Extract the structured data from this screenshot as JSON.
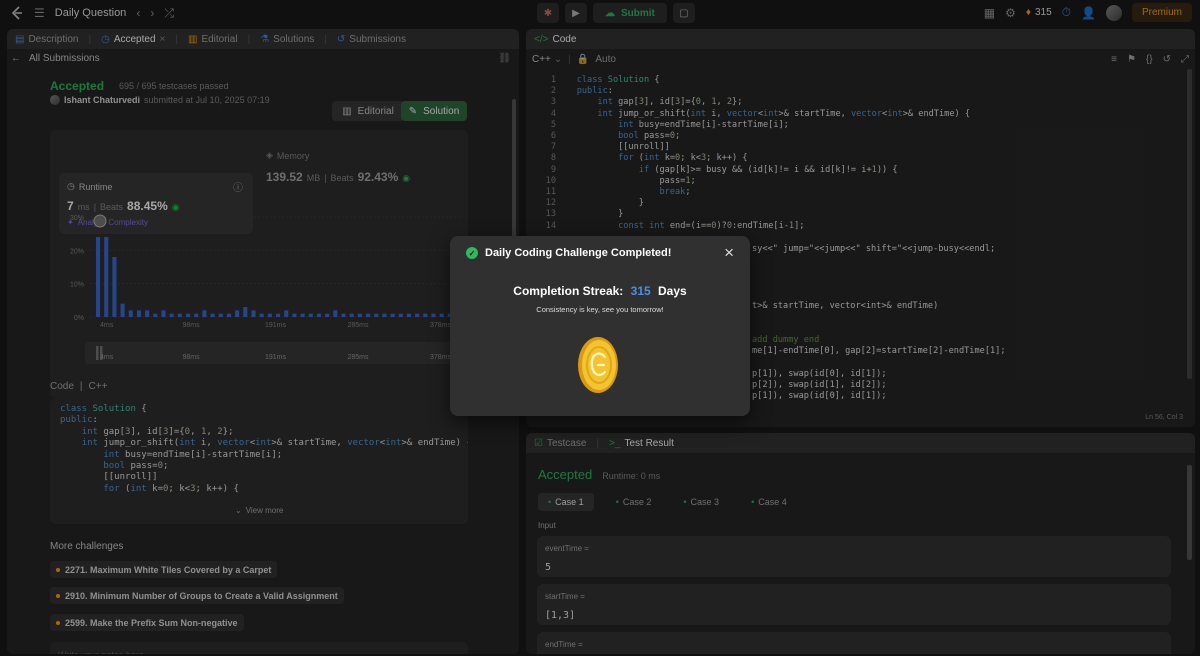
{
  "topbar": {
    "title": "Daily Question",
    "submit": "Submit",
    "streak": "315",
    "premium": "Premium"
  },
  "left_tabs": [
    "Description",
    "Accepted",
    "Editorial",
    "Solutions",
    "Submissions"
  ],
  "all_submissions": "All Submissions",
  "result": {
    "status": "Accepted",
    "testcases": "695 / 695 testcases passed",
    "user": "Ishant Chaturvedi",
    "submitted": "submitted at Jul 10, 2025 07:19",
    "editorial_btn": "Editorial",
    "solution_btn": "Solution"
  },
  "runtime": {
    "label": "Runtime",
    "value": "7",
    "unit": "ms",
    "beats_label": "Beats",
    "beats": "88.45%",
    "analyze": "Analyze Complexity"
  },
  "memory": {
    "label": "Memory",
    "value": "139.52",
    "unit": "MB",
    "beats_label": "Beats",
    "beats": "92.43%"
  },
  "chart_data": {
    "type": "bar",
    "ylabel_ticks": [
      "30%",
      "20%",
      "10%",
      "0%"
    ],
    "xticks": [
      "4ms",
      "98ms",
      "191ms",
      "285ms",
      "378ms"
    ],
    "values": [
      24,
      24,
      18,
      4,
      2,
      2,
      2,
      1,
      2,
      1,
      1,
      1,
      1,
      2,
      1,
      1,
      1,
      2,
      3,
      2,
      1,
      1,
      1,
      2,
      1,
      1,
      1,
      1,
      1,
      2,
      1,
      1,
      1,
      1,
      1,
      1,
      1,
      1,
      1,
      1,
      1,
      1,
      1,
      1
    ],
    "ylim": [
      0,
      30
    ]
  },
  "mini_ticks": [
    "4ms",
    "98ms",
    "191ms",
    "285ms",
    "378ms"
  ],
  "code_label": "Code",
  "code_lang": "C++",
  "code_lines_preview": [
    "class Solution {",
    "public:",
    "    int gap[3], id[3]={0, 1, 2};",
    "    int jump_or_shift(int i, vector<int>& startTime, vector<int>& endTime) {",
    "        int busy=endTime[i]-startTime[i];",
    "        bool pass=0;",
    "        [[unroll]]",
    "        for (int k=0; k<3; k++) {"
  ],
  "view_more": "View more",
  "more_challenges": "More challenges",
  "challenges": [
    "2271. Maximum White Tiles Covered by a Carpet",
    "2910. Minimum Number of Groups to Create a Valid Assignment",
    "2599. Make the Prefix Sum Non-negative"
  ],
  "notes_placeholder": "Write your notes here",
  "editor": {
    "tab": "Code",
    "lang": "C++",
    "auto": "Auto",
    "cursor": "Ln 56, Col 3",
    "lines": [
      {
        "n": "1",
        "t": "class Solution {"
      },
      {
        "n": "2",
        "t": "public:"
      },
      {
        "n": "3",
        "t": "    int gap[3], id[3]={0, 1, 2};"
      },
      {
        "n": "4",
        "t": "    int jump_or_shift(int i, vector<int>& startTime, vector<int>& endTime) {"
      },
      {
        "n": "5",
        "t": "        int busy=endTime[i]-startTime[i];"
      },
      {
        "n": "6",
        "t": "        bool pass=0;"
      },
      {
        "n": "7",
        "t": "        [[unroll]]"
      },
      {
        "n": "8",
        "t": "        for (int k=0; k<3; k++) {"
      },
      {
        "n": "9",
        "t": "            if (gap[k]>= busy && (id[k]!= i && id[k]!= i+1)) {"
      },
      {
        "n": "10",
        "t": "                pass=1;"
      },
      {
        "n": "11",
        "t": "                break;"
      },
      {
        "n": "12",
        "t": "            }"
      },
      {
        "n": "13",
        "t": "        }"
      },
      {
        "n": "14",
        "t": "        const int end=(i==0)?0:endTime[i-1];"
      }
    ],
    "hidden_fragments": [
      "sy<<\" jump=\"<<jump<<\" shift=\"<<jump-busy<<endl;",
      "t>& startTime, vector<int>& endTime)",
      "add dummy end",
      "me[1]-endTime[0], gap[2]=startTime[2]-endTime[1];",
      "p[1]), swap(id[0], id[1]);",
      "p[2]), swap(id[1], id[2]);",
      "p[1]), swap(id[0], id[1]);"
    ]
  },
  "testpanel": {
    "tab1": "Testcase",
    "tab2": "Test Result",
    "status": "Accepted",
    "runtime": "Runtime: 0 ms",
    "cases": [
      "Case 1",
      "Case 2",
      "Case 3",
      "Case 4"
    ],
    "input_label": "Input",
    "fields": [
      {
        "label": "eventTime =",
        "value": "5"
      },
      {
        "label": "startTime =",
        "value": "[1,3]"
      },
      {
        "label": "endTime =",
        "value": ""
      }
    ]
  },
  "modal": {
    "title": "Daily Coding Challenge Completed!",
    "streak_label": "Completion Streak:",
    "streak_value": "315",
    "streak_unit": "Days",
    "message": "Consistency is key, see you tomorrow!"
  },
  "colors": {
    "accent_green": "#2cbb5d",
    "orange": "#ffa116",
    "streak_blue": "#4a90e2",
    "bar_blue": "#3b6bd6"
  }
}
